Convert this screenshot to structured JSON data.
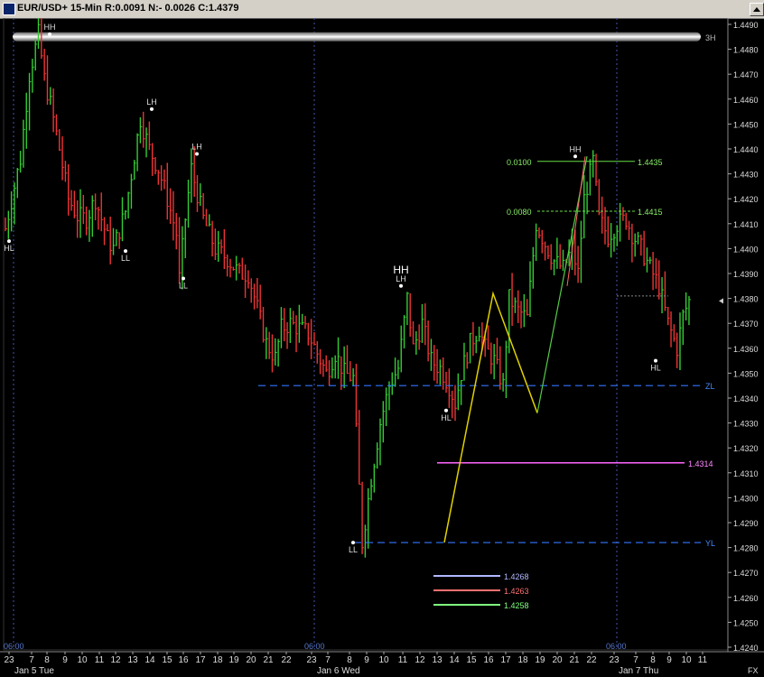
{
  "window": {
    "title": "EUR/USD+ 15-Min R:0.0091 N:- 0.0026 C:1.4379"
  },
  "y_axis": {
    "labels": [
      "1.4490",
      "1.4480",
      "1.4470",
      "1.4460",
      "1.4450",
      "1.4440",
      "1.4430",
      "1.4420",
      "1.4410",
      "1.4400",
      "1.4390",
      "1.4380",
      "1.4370",
      "1.4360",
      "1.4350",
      "1.4340",
      "1.4330",
      "1.4320",
      "1.4310",
      "1.4300",
      "1.4290",
      "1.4280",
      "1.4270",
      "1.4260",
      "1.4250",
      "1.4240"
    ]
  },
  "x_axis": {
    "hour_labels": [
      "23",
      "7",
      "8",
      "9",
      "10",
      "11",
      "12",
      "13",
      "14",
      "15",
      "16",
      "17",
      "18",
      "19",
      "20",
      "21",
      "22",
      "23",
      "7",
      "8",
      "9",
      "10",
      "11",
      "12",
      "13",
      "14",
      "15",
      "16",
      "17",
      "18",
      "19",
      "20",
      "21",
      "22",
      "23",
      "7",
      "8",
      "9",
      "10",
      "11"
    ],
    "day_labels": [
      "Jan 5 Tue",
      "Jan 6 Wed",
      "Jan 7 Thu"
    ],
    "session_labels": [
      "06:00",
      "06:00",
      "06:00"
    ],
    "corner_label": "FX"
  },
  "markers": {
    "hh1": "HH",
    "hl1": "HL",
    "lh1": "LH",
    "ll1": "LL",
    "ll2": "LL",
    "lh2": "LH",
    "hh2_big": "HH",
    "lh3": "LH",
    "ll3": "LL",
    "hl2": "HL",
    "hh3": "HH",
    "hl3": "HL"
  },
  "levels": {
    "band_label": "3H",
    "zl_label": "ZL",
    "yl_label": "YL",
    "magenta_value": "1.4314",
    "fib_top_left": "0.0100",
    "fib_top_right": "1.4435",
    "fib_mid_left": "0.0080",
    "fib_mid_right": "1.4415"
  },
  "legend": [
    {
      "value": "1.4268",
      "color": "#b0b8ff"
    },
    {
      "value": "1.4263",
      "color": "#ff7070"
    },
    {
      "value": "1.4258",
      "color": "#80ff80"
    }
  ],
  "colors": {
    "up_bar": "#33cc33",
    "down_bar": "#ee3333",
    "zl_line": "#3377ff",
    "magenta": "#ff66ff",
    "yellow_path": "#e0d000",
    "fib_green": "#66dd44"
  },
  "chart_data": {
    "type": "ohlc",
    "y_range": [
      1.4238,
      1.4496
    ],
    "x_labels_note": "15-minute bars; hour ticks shown on x-axis",
    "price_path": [
      [
        0,
        1.4408
      ],
      [
        3,
        1.4425
      ],
      [
        5,
        1.4436
      ],
      [
        8,
        1.447
      ],
      [
        11,
        1.4486
      ],
      [
        13,
        1.4468
      ],
      [
        15,
        1.4458
      ],
      [
        18,
        1.444
      ],
      [
        21,
        1.442
      ],
      [
        24,
        1.4413
      ],
      [
        27,
        1.4412
      ],
      [
        30,
        1.442
      ],
      [
        34,
        1.4404
      ],
      [
        36,
        1.44
      ],
      [
        40,
        1.4415
      ],
      [
        45,
        1.4452
      ],
      [
        48,
        1.444
      ],
      [
        51,
        1.4432
      ],
      [
        54,
        1.442
      ],
      [
        57,
        1.4406
      ],
      [
        58,
        1.4388
      ],
      [
        60,
        1.4412
      ],
      [
        62,
        1.4432
      ],
      [
        66,
        1.4412
      ],
      [
        70,
        1.44
      ],
      [
        74,
        1.4396
      ],
      [
        78,
        1.439
      ],
      [
        81,
        1.439
      ],
      [
        84,
        1.4376
      ],
      [
        87,
        1.4362
      ],
      [
        90,
        1.4356
      ],
      [
        92,
        1.4368
      ],
      [
        95,
        1.437
      ],
      [
        98,
        1.4368
      ],
      [
        101,
        1.4366
      ],
      [
        104,
        1.4358
      ],
      [
        107,
        1.435
      ],
      [
        110,
        1.4358
      ],
      [
        113,
        1.435
      ],
      [
        116,
        1.4348
      ],
      [
        119,
        1.4282
      ],
      [
        122,
        1.4308
      ],
      [
        125,
        1.433
      ],
      [
        128,
        1.4345
      ],
      [
        131,
        1.4352
      ],
      [
        134,
        1.438
      ],
      [
        136,
        1.436
      ],
      [
        139,
        1.437
      ],
      [
        142,
        1.4355
      ],
      [
        145,
        1.4352
      ],
      [
        148,
        1.4345
      ],
      [
        150,
        1.4338
      ],
      [
        152,
        1.435
      ],
      [
        155,
        1.4362
      ],
      [
        158,
        1.4368
      ],
      [
        160,
        1.436
      ],
      [
        163,
        1.4355
      ],
      [
        166,
        1.4345
      ],
      [
        168,
        1.438
      ],
      [
        171,
        1.4375
      ],
      [
        174,
        1.4372
      ],
      [
        177,
        1.441
      ],
      [
        180,
        1.4402
      ],
      [
        183,
        1.4395
      ],
      [
        186,
        1.4392
      ],
      [
        189,
        1.44
      ],
      [
        191,
        1.439
      ],
      [
        193,
        1.442
      ],
      [
        196,
        1.4435
      ],
      [
        198,
        1.4412
      ],
      [
        201,
        1.4405
      ],
      [
        204,
        1.441
      ],
      [
        207,
        1.4412
      ],
      [
        209,
        1.4406
      ],
      [
        212,
        1.44
      ],
      [
        215,
        1.4392
      ],
      [
        218,
        1.4385
      ],
      [
        221,
        1.437
      ],
      [
        224,
        1.436
      ],
      [
        226,
        1.4373
      ],
      [
        228,
        1.4379
      ]
    ],
    "annotation_levels": {
      "ZL": 1.4345,
      "YL": 1.4282,
      "magenta": 1.4314,
      "fib_0100": 1.4435,
      "fib_0080": 1.4415,
      "band_3H": 1.4485
    }
  }
}
